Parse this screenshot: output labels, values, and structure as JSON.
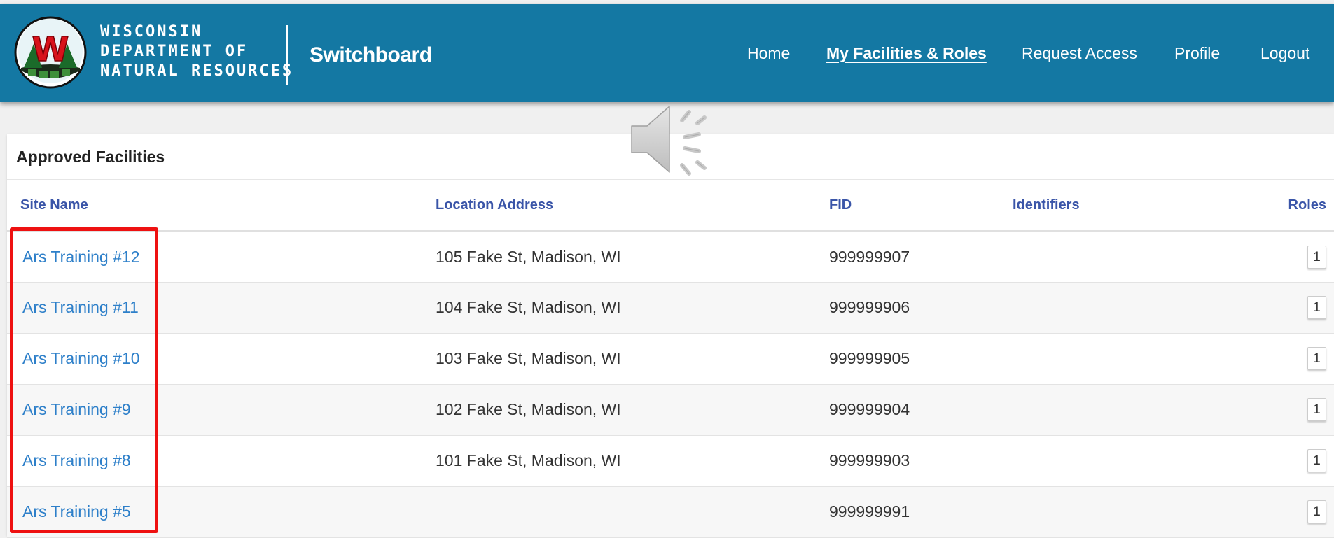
{
  "header": {
    "agency_lines": [
      "WISCONSIN",
      "DEPARTMENT OF",
      "NATURAL RESOURCES"
    ],
    "logo_letter": "W",
    "app_title": "Switchboard",
    "nav": [
      {
        "label": "Home",
        "active": false
      },
      {
        "label": "My Facilities & Roles",
        "active": true
      },
      {
        "label": "Request Access",
        "active": false
      },
      {
        "label": "Profile",
        "active": false
      },
      {
        "label": "Logout",
        "active": false
      }
    ]
  },
  "overlay": {
    "icon": "speaker-icon"
  },
  "panel": {
    "title": "Approved Facilities",
    "columns": {
      "site_name": "Site Name",
      "location_address": "Location Address",
      "fid": "FID",
      "identifiers": "Identifiers",
      "roles": "Roles"
    },
    "rows": [
      {
        "site_name": "Ars Training #12",
        "address": "105 Fake St, Madison, WI",
        "fid": "999999907",
        "identifiers": "",
        "roles": "1"
      },
      {
        "site_name": "Ars Training #11",
        "address": "104 Fake St, Madison, WI",
        "fid": "999999906",
        "identifiers": "",
        "roles": "1"
      },
      {
        "site_name": "Ars Training #10",
        "address": "103 Fake St, Madison, WI",
        "fid": "999999905",
        "identifiers": "",
        "roles": "1"
      },
      {
        "site_name": "Ars Training #9",
        "address": "102 Fake St, Madison, WI",
        "fid": "999999904",
        "identifiers": "",
        "roles": "1"
      },
      {
        "site_name": "Ars Training #8",
        "address": "101 Fake St, Madison, WI",
        "fid": "999999903",
        "identifiers": "",
        "roles": "1"
      },
      {
        "site_name": "Ars Training #5",
        "address": "",
        "fid": "999999991",
        "identifiers": "",
        "roles": "1"
      }
    ]
  },
  "colors": {
    "header_bg": "#1478a3",
    "link": "#2d7fc9",
    "column_header": "#3a55a8",
    "highlight": "#ee1111"
  }
}
